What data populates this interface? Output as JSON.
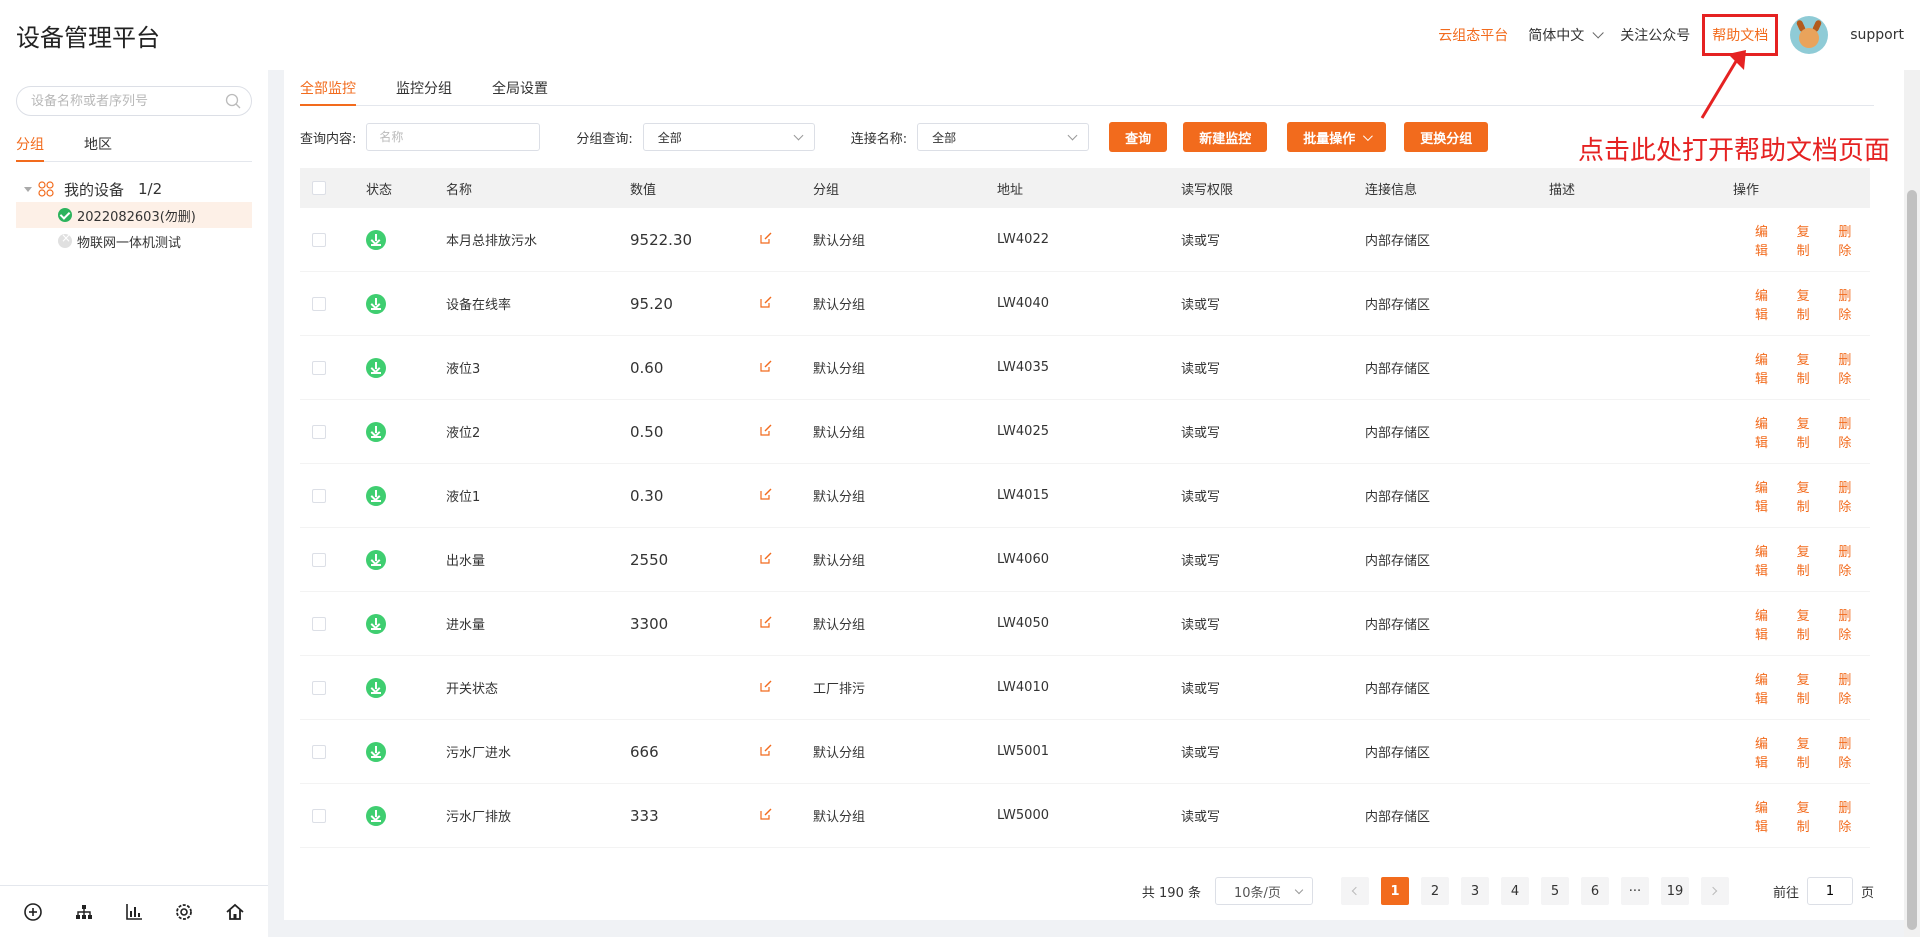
{
  "header": {
    "title": "设备管理平台",
    "links": [
      {
        "label": "云组态平台",
        "accent": true
      },
      {
        "label": "简体中文",
        "dropdown": true
      },
      {
        "label": "关注公众号"
      }
    ],
    "help_label": "帮助文档",
    "user_name": "support"
  },
  "sidebar": {
    "search_placeholder": "设备名称或者序列号",
    "tabs": [
      "分组",
      "地区"
    ],
    "tree": {
      "root_label": "我的设备",
      "root_count": "1/2",
      "items": [
        {
          "label": "2022082603(勿删)",
          "online": true,
          "selected": true
        },
        {
          "label": "物联网一体机测试",
          "online": false,
          "selected": false
        }
      ]
    },
    "bottom_icons": [
      "add-circle-icon",
      "hierarchy-icon",
      "chart-icon",
      "settings-icon",
      "home-icon"
    ]
  },
  "main": {
    "tabs": [
      "全部监控",
      "监控分组",
      "全局设置"
    ],
    "filters": {
      "query_label": "查询内容:",
      "query_placeholder": "名称",
      "group_label": "分组查询:",
      "group_value": "全部",
      "conn_label": "连接名称:",
      "conn_value": "全部"
    },
    "buttons": {
      "search": "查询",
      "new_monitor": "新建监控",
      "batch": "批量操作",
      "change_group": "更换分组"
    },
    "annotation": "点击此处打开帮助文档页面",
    "table": {
      "columns": [
        "状态",
        "名称",
        "数值",
        "分组",
        "地址",
        "读写权限",
        "连接信息",
        "描述",
        "操作"
      ],
      "rows": [
        {
          "name": "本月总排放污水",
          "value": "9522.30",
          "group": "默认分组",
          "addr": "LW4022",
          "rw": "读或写",
          "conn": "内部存储区",
          "desc": ""
        },
        {
          "name": "设备在线率",
          "value": "95.20",
          "group": "默认分组",
          "addr": "LW4040",
          "rw": "读或写",
          "conn": "内部存储区",
          "desc": ""
        },
        {
          "name": "液位3",
          "value": "0.60",
          "group": "默认分组",
          "addr": "LW4035",
          "rw": "读或写",
          "conn": "内部存储区",
          "desc": ""
        },
        {
          "name": "液位2",
          "value": "0.50",
          "group": "默认分组",
          "addr": "LW4025",
          "rw": "读或写",
          "conn": "内部存储区",
          "desc": ""
        },
        {
          "name": "液位1",
          "value": "0.30",
          "group": "默认分组",
          "addr": "LW4015",
          "rw": "读或写",
          "conn": "内部存储区",
          "desc": ""
        },
        {
          "name": "出水量",
          "value": "2550",
          "group": "默认分组",
          "addr": "LW4060",
          "rw": "读或写",
          "conn": "内部存储区",
          "desc": ""
        },
        {
          "name": "进水量",
          "value": "3300",
          "group": "默认分组",
          "addr": "LW4050",
          "rw": "读或写",
          "conn": "内部存储区",
          "desc": ""
        },
        {
          "name": "开关状态",
          "value": "",
          "group": "工厂排污",
          "addr": "LW4010",
          "rw": "读或写",
          "conn": "内部存储区",
          "desc": ""
        },
        {
          "name": "污水厂进水",
          "value": "666",
          "group": "默认分组",
          "addr": "LW5001",
          "rw": "读或写",
          "conn": "内部存储区",
          "desc": ""
        },
        {
          "name": "污水厂排放",
          "value": "333",
          "group": "默认分组",
          "addr": "LW5000",
          "rw": "读或写",
          "conn": "内部存储区",
          "desc": ""
        }
      ],
      "ops": [
        "编辑",
        "复制",
        "删除"
      ]
    },
    "pagination": {
      "total": "共 190 条",
      "page_size": "10条/页",
      "pages": [
        "1",
        "2",
        "3",
        "4",
        "5",
        "6",
        "···",
        "19"
      ],
      "current": "1",
      "goto_prefix": "前往",
      "goto_value": "1",
      "goto_suffix": "页"
    }
  },
  "colors": {
    "accent": "#f26b1d",
    "annotation": "#e52222",
    "online": "#2db35d"
  }
}
